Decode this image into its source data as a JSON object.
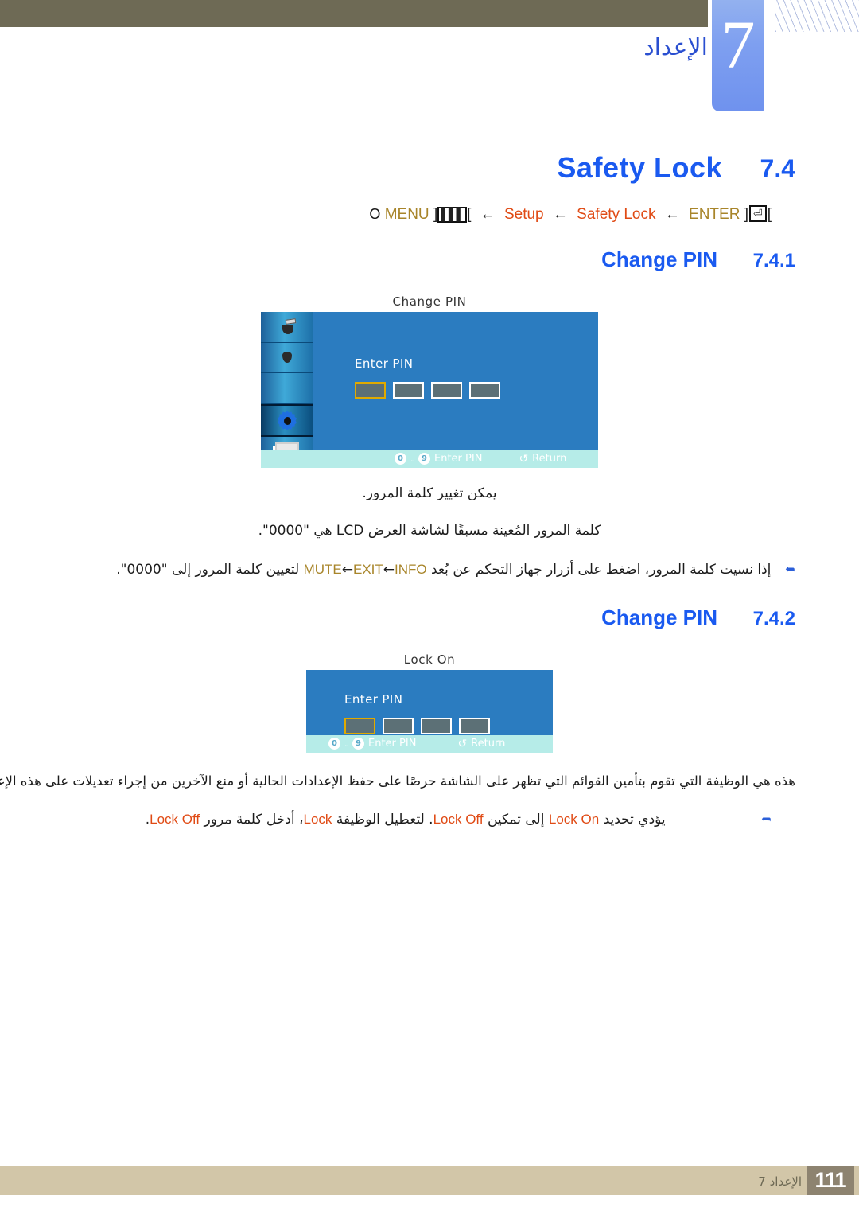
{
  "header": {
    "chapter_number": "7",
    "chapter_title_ar": "الإعداد"
  },
  "section": {
    "title": "Safety Lock",
    "number": "7.4",
    "breadcrumb": {
      "enter_key_icon": "enter-key-icon",
      "enter_label": "ENTER",
      "arrow": "←",
      "safety_lock": "Safety Lock",
      "setup": "Setup",
      "menu_key_icon": "menu-key-icon",
      "menu_label": "MENU",
      "circle": "O",
      "bracket_open": "[",
      "bracket_close": "]"
    }
  },
  "subsections": [
    {
      "title": "Change PIN",
      "number": "7.4.1",
      "osd": {
        "caption": "Change PIN",
        "field_label": "Enter PIN",
        "pin_boxes": 4,
        "active_box_index": 0,
        "footer_hint_1": "Enter PIN",
        "footer_hint_2": "Return",
        "key_low": "0",
        "key_high": "9",
        "key_dots": "..",
        "return_icon": "↺",
        "sidebar_icons": [
          "brush-icon",
          "droplet-icon",
          "blank-icon",
          "gear-icon",
          "monitor-icon"
        ]
      },
      "paragraphs": [
        "يمكن تغيير كلمة المرور.",
        "كلمة المرور المُعينة مسبقًا لشاشة العرض LCD هي \"0000\"."
      ],
      "bullet": {
        "icon": "note-arrow-icon",
        "pre": "إذا نسيت كلمة المرور، اضغط على أزرار جهاز التحكم عن بُعد ",
        "k1": "INFO",
        "arrow1": " ← ",
        "k2": "EXIT",
        "arrow2": " ← ",
        "k3": "MUTE",
        "post": " لتعيين كلمة المرور إلى \"0000\"."
      }
    },
    {
      "title": "Change PIN",
      "number": "7.4.2",
      "osd": {
        "caption": "Lock On",
        "field_label": "Enter PIN",
        "pin_boxes": 4,
        "active_box_index": 0,
        "footer_hint_1": "Enter PIN",
        "footer_hint_2": "Return",
        "key_low": "0",
        "key_high": "9",
        "key_dots": "..",
        "return_icon": "↺"
      },
      "paragraphs": [
        "هذه هي الوظيفة التي تقوم بتأمين القوائم التي تظهر على الشاشة حرصًا على حفظ الإعدادات الحالية أو منع الآخرين من إجراء تعديلات على هذه الإعدادات."
      ],
      "bullet": {
        "icon": "note-arrow-icon",
        "pre": "يؤدي تحديد ",
        "k1": "Lock On",
        "mid1": " إلى تمكين ",
        "k2": "Lock Off",
        "mid2": ". لتعطيل الوظيفة ",
        "k3": "Lock",
        "mid3": "، أدخل كلمة مرور ",
        "k4": "Lock Off",
        "post": "."
      }
    }
  ],
  "footer": {
    "chapter_ar": "الإعداد 7",
    "page_number": "111"
  },
  "colors": {
    "accent_blue": "#1a5af0",
    "gold": "#a8852a",
    "orange": "#e04a14",
    "band_olive": "#6e6a55",
    "footer_tan": "#d2c6a8",
    "footer_page_bg": "#8d8370",
    "osd_blue": "#2b7cc0",
    "osd_footer_mint": "#b6ece8"
  }
}
